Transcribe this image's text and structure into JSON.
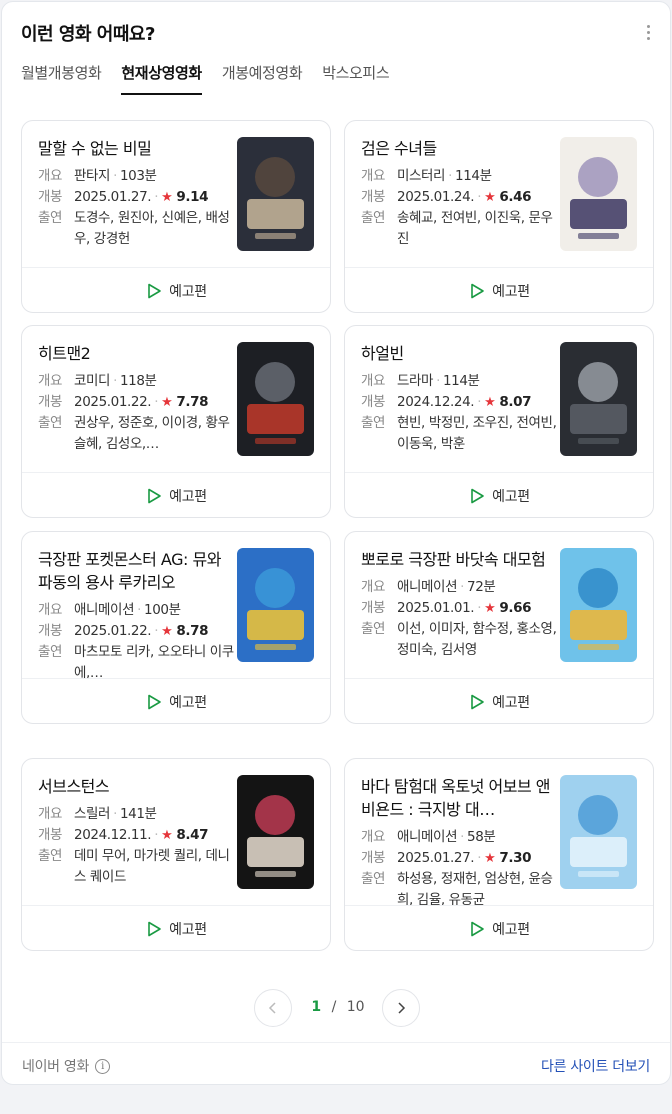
{
  "header": {
    "title": "이런 영화 어때요?"
  },
  "tabs": [
    {
      "label": "월별개봉영화",
      "active": false
    },
    {
      "label": "현재상영영화",
      "active": true
    },
    {
      "label": "개봉예정영화",
      "active": false
    },
    {
      "label": "박스오피스",
      "active": false
    }
  ],
  "labels": {
    "genre": "개요",
    "release": "개봉",
    "cast": "출연",
    "trailer": "예고편"
  },
  "movies": [
    {
      "title": "말할 수 없는 비밀",
      "genre": "판타지",
      "runtime": "103분",
      "date": "2025.01.27.",
      "rating": "9.14",
      "cast": "도경수, 원진아, 신예은, 배성우, 강경헌"
    },
    {
      "title": "검은 수녀들",
      "genre": "미스터리",
      "runtime": "114분",
      "date": "2025.01.24.",
      "rating": "6.46",
      "cast": "송혜교, 전여빈, 이진욱, 문우진"
    },
    {
      "title": "히트맨2",
      "genre": "코미디",
      "runtime": "118분",
      "date": "2025.01.22.",
      "rating": "7.78",
      "cast": "권상우, 정준호, 이이경, 황우슬혜, 김성오,…"
    },
    {
      "title": "하얼빈",
      "genre": "드라마",
      "runtime": "114분",
      "date": "2024.12.24.",
      "rating": "8.07",
      "cast": "현빈, 박정민, 조우진, 전여빈, 이동욱, 박훈"
    },
    {
      "title": "극장판 포켓몬스터 AG: 뮤와 파동의 용사 루카리오",
      "genre": "애니메이션",
      "runtime": "100분",
      "date": "2025.01.22.",
      "rating": "8.78",
      "cast": "마츠모토 리카, 오오타니 이쿠에,…"
    },
    {
      "title": "뽀로로 극장판 바닷속 대모험",
      "genre": "애니메이션",
      "runtime": "72분",
      "date": "2025.01.01.",
      "rating": "9.66",
      "cast": "이선, 이미자, 함수정, 홍소영, 정미숙, 김서영"
    },
    {
      "title": "서브스턴스",
      "genre": "스릴러",
      "runtime": "141분",
      "date": "2024.12.11.",
      "rating": "8.47",
      "cast": "데미 무어, 마가렛 퀄리, 데니스 퀘이드"
    },
    {
      "title": "바다 탐험대 옥토넛 어보브 앤 비욘드 : 극지방 대…",
      "genre": "애니메이션",
      "runtime": "58분",
      "date": "2025.01.27.",
      "rating": "7.30",
      "cast": "하성용, 정재헌, 엄상현, 윤승희, 김율, 유동균"
    }
  ],
  "pager": {
    "current": "1",
    "separator": "/",
    "total": "10"
  },
  "footer": {
    "source": "네이버 영화",
    "more": "다른 사이트 더보기"
  },
  "colors": {
    "accent": "#1a9a43",
    "rating_star": "#e5363b",
    "link": "#2451b7"
  }
}
